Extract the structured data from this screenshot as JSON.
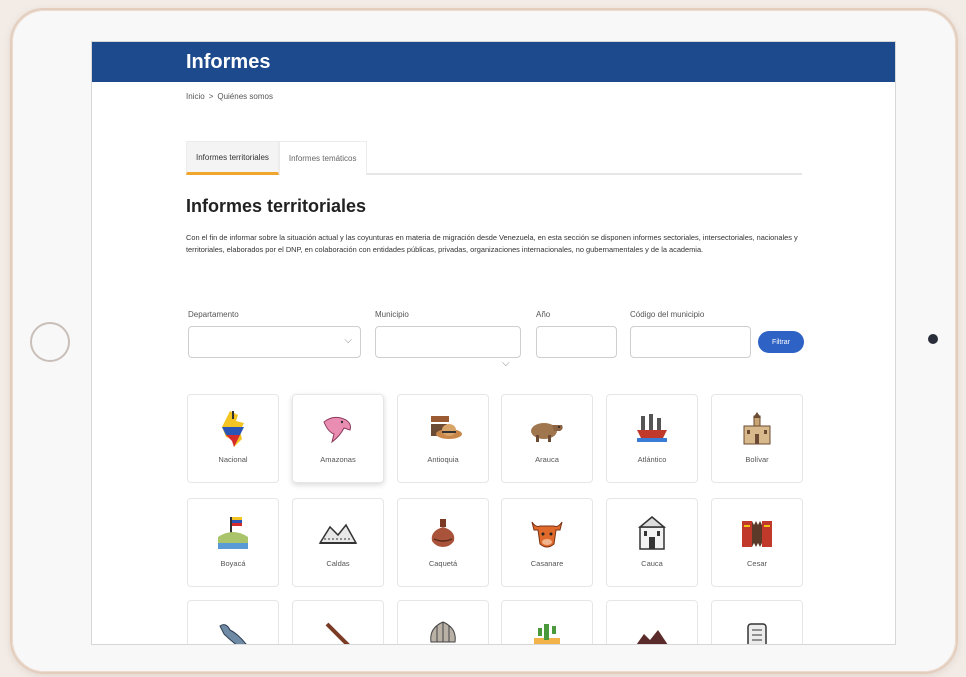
{
  "header": {
    "title": "Informes"
  },
  "breadcrumb": {
    "home": "Inicio",
    "separator": ">",
    "current": "Quiénes somos"
  },
  "tabs": [
    {
      "label": "Informes territoriales",
      "active": true
    },
    {
      "label": "Informes temáticos",
      "active": false
    }
  ],
  "section": {
    "title": "Informes territoriales",
    "description": "Con el fin de informar sobre la situación actual y las coyunturas en materia de migración desde Venezuela, en esta sección se disponen informes sectoriales, intersectoriales, nacionales y territoriales, elaborados por el DNP, en colaboración con entidades públicas, privadas, organizaciones internacionales, no gubernamentales y de la academia."
  },
  "filters": {
    "departamento_label": "Departamento",
    "departamento_value": "",
    "municipio_label": "Municipio",
    "municipio_value": "",
    "anio_label": "Año",
    "anio_value": "",
    "codigo_label": "Código del municipio",
    "codigo_value": "",
    "filter_button": "Filtrar"
  },
  "cards_row1": [
    {
      "name": "Nacional",
      "icon": "colombia-map-icon"
    },
    {
      "name": "Amazonas",
      "icon": "dolphin-icon"
    },
    {
      "name": "Antioquia",
      "icon": "hat-icon"
    },
    {
      "name": "Arauca",
      "icon": "capybara-icon"
    },
    {
      "name": "Atlántico",
      "icon": "ship-icon"
    },
    {
      "name": "Bolívar",
      "icon": "castle-icon"
    }
  ],
  "cards_row2": [
    {
      "name": "Boyacá",
      "icon": "bridge-flag-icon"
    },
    {
      "name": "Caldas",
      "icon": "mountain-snow-icon"
    },
    {
      "name": "Caquetá",
      "icon": "jug-icon"
    },
    {
      "name": "Casanare",
      "icon": "bull-icon"
    },
    {
      "name": "Cauca",
      "icon": "church-icon"
    },
    {
      "name": "Cesar",
      "icon": "accordion-icon"
    }
  ],
  "cards_row3": [
    {
      "name": "",
      "icon": "whale-icon"
    },
    {
      "name": "",
      "icon": "flute-icon"
    },
    {
      "name": "",
      "icon": "shell-icon"
    },
    {
      "name": "",
      "icon": "cactus-icon"
    },
    {
      "name": "",
      "icon": "mountains-icon"
    },
    {
      "name": "",
      "icon": "stone-tablet-icon"
    }
  ],
  "colors": {
    "header": "#1d4a8d",
    "accent": "#f0a52c",
    "button": "#2e63c5"
  }
}
